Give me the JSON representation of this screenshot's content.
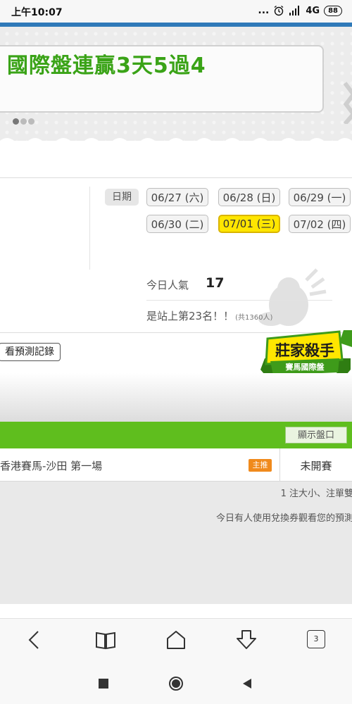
{
  "status_bar": {
    "time": "上午10:07",
    "dots": "...",
    "network": "4G",
    "battery": "88"
  },
  "banner": {
    "headline": "國際盤連贏3天5過4"
  },
  "dates": {
    "label": "日期",
    "items": [
      {
        "text": "06/27 (六)",
        "selected": false
      },
      {
        "text": "06/28 (日)",
        "selected": false
      },
      {
        "text": "06/29 (一)",
        "selected": false
      },
      {
        "text": "06/30 (二)",
        "selected": false
      },
      {
        "text": "07/01 (三)",
        "selected": true
      },
      {
        "text": "07/02 (四)",
        "selected": false
      }
    ]
  },
  "stats": {
    "popularity_label": "今日人氣",
    "popularity_value": "17",
    "rank_text": "是站上第23名！！",
    "rank_total": "(共1360人)"
  },
  "promo": {
    "history_button": "看預測記錄",
    "badge_title": "莊家殺手",
    "badge_subtitle": "賽馬國際盤"
  },
  "race_section": {
    "show_odds_button": "顯示盤口",
    "race_name": "香港賽馬-沙田 第一場",
    "tag": "主推",
    "status": "未開賽",
    "note_stake": "1 注大小、注單雙",
    "note_voucher": "今日有人使用兌換券觀看您的預測"
  },
  "browser_nav": {
    "tab_count": "3"
  },
  "colors": {
    "accent_blue": "#2f7ab9",
    "banner_green": "#3aa317",
    "section_green": "#5fbe1e",
    "selected_yellow": "#ffe600",
    "tag_orange": "#f08a1c"
  }
}
